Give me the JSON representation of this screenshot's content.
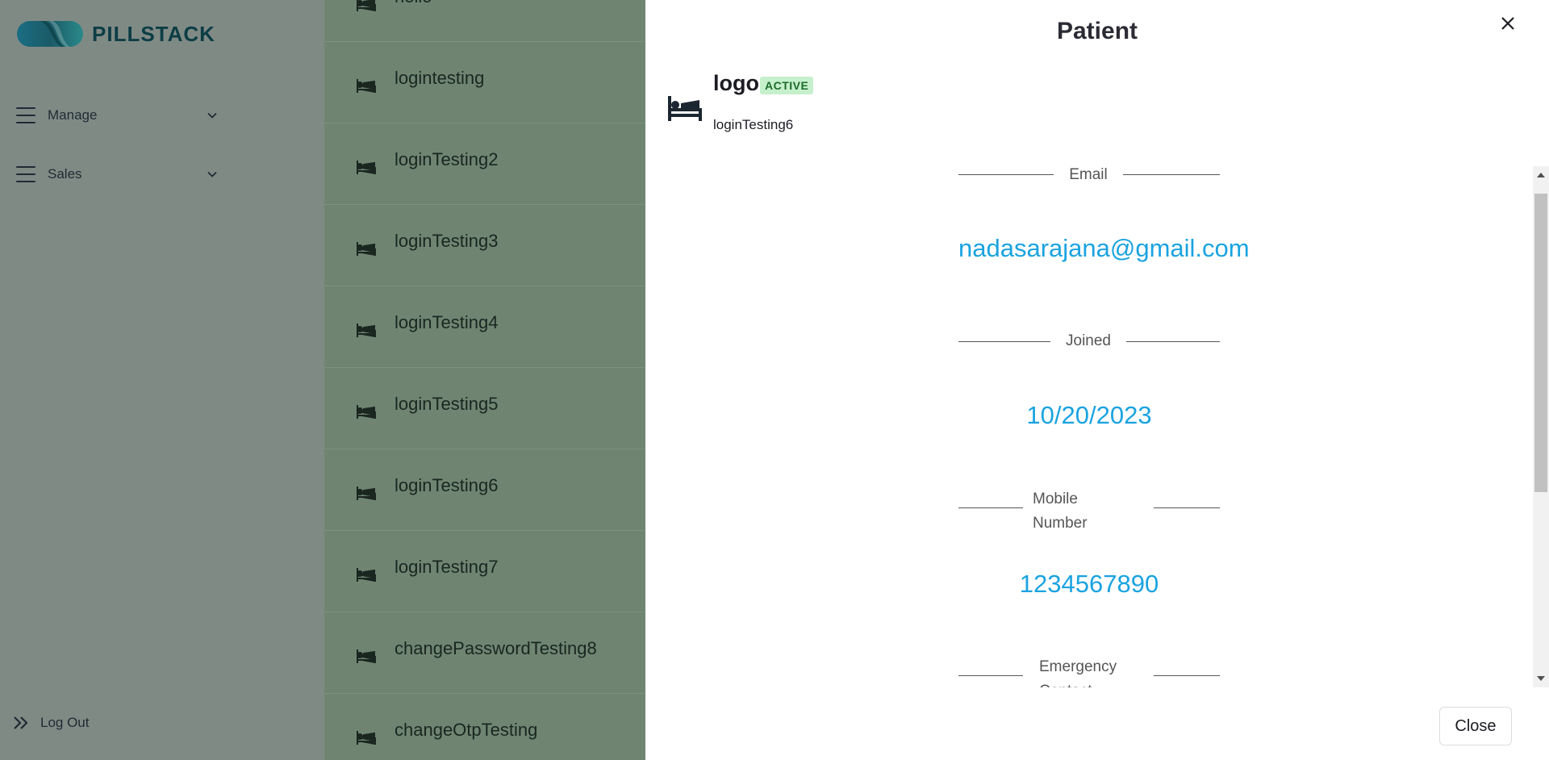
{
  "brand": {
    "name": "PILLSTACK"
  },
  "sidebar": {
    "items": [
      {
        "label": "Manage",
        "icon": "menu-icon"
      },
      {
        "label": "Sales",
        "icon": "menu-icon"
      }
    ],
    "logout": {
      "label": "Log Out",
      "icon": "double-chevron-right-icon"
    }
  },
  "patient_list": {
    "items": [
      {
        "label": "hello"
      },
      {
        "label": "logintesting"
      },
      {
        "label": "loginTesting2"
      },
      {
        "label": "loginTesting3"
      },
      {
        "label": "loginTesting4"
      },
      {
        "label": "loginTesting5"
      },
      {
        "label": "loginTesting6"
      },
      {
        "label": "loginTesting7"
      },
      {
        "label": "changePasswordTesting8"
      },
      {
        "label": "changeOtpTesting"
      }
    ]
  },
  "drawer": {
    "title": "Patient",
    "name": "logo",
    "status": "ACTIVE",
    "username": "loginTesting6",
    "fields": {
      "email_label": "Email",
      "email": "nadasarajana@gmail.com",
      "joined_label": "Joined",
      "joined": "10/20/2023",
      "mobile_label": "Mobile Number",
      "mobile": "1234567890",
      "emergency_label": "Emergency Contact"
    },
    "close_label": "Close"
  },
  "colors": {
    "accent": "#1aa3e0",
    "brand": "#0c3d45",
    "list_bg": "#6f8572",
    "sidebar_bg": "#808a85",
    "badge_bg": "#c6f0cb"
  }
}
